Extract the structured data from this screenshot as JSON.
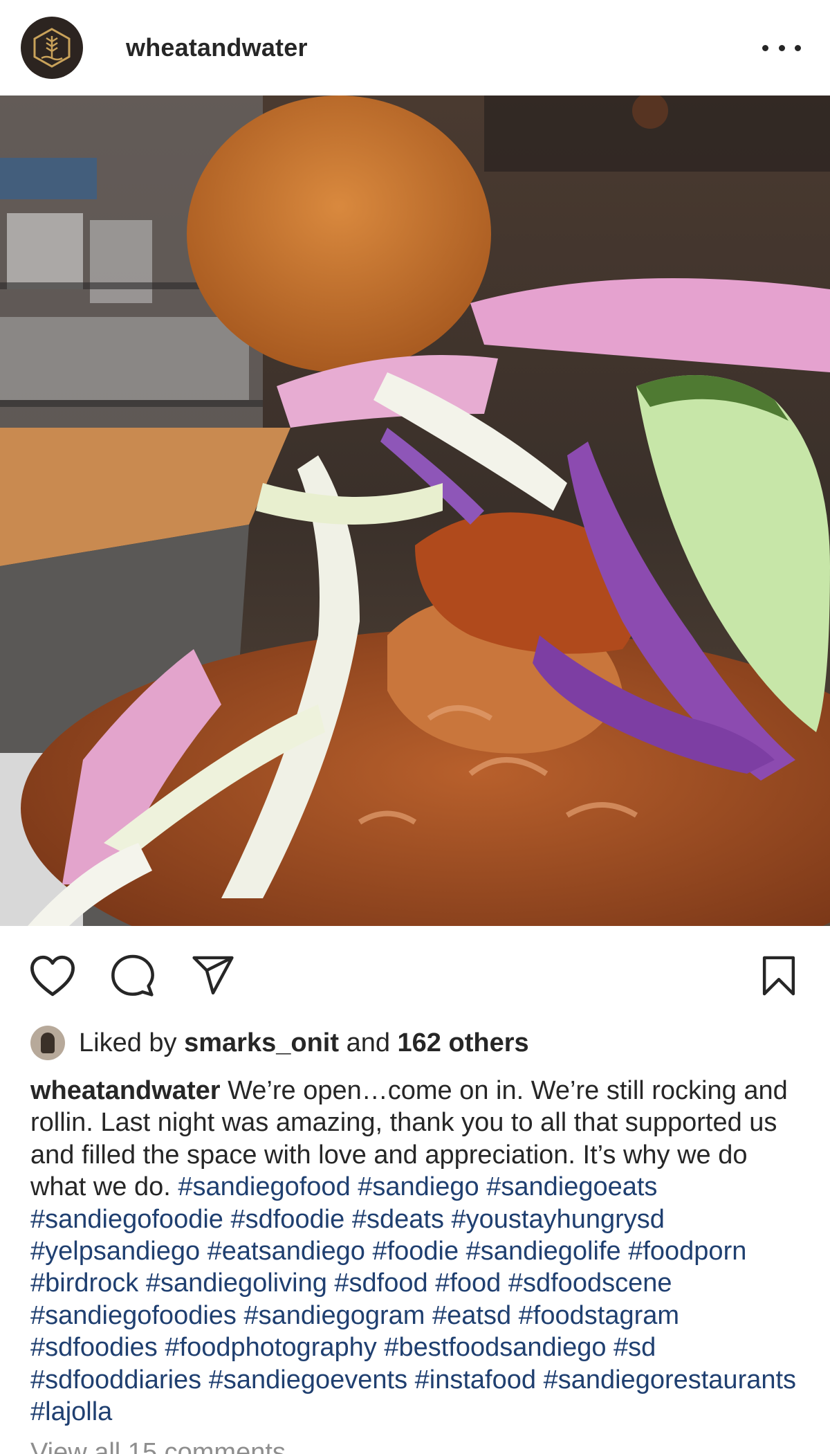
{
  "post": {
    "username": "wheatandwater",
    "more_icon": "more-horizontal-icon",
    "avatar_icon": "wheat-logo-icon"
  },
  "actions": {
    "like_icon": "heart-icon",
    "comment_icon": "comment-icon",
    "share_icon": "send-icon",
    "save_icon": "bookmark-icon"
  },
  "likes": {
    "prefix": "Liked by",
    "user": "smarks_onit",
    "middle": "and",
    "others": "162 others"
  },
  "caption": {
    "username": "wheatandwater",
    "text": "We’re open…come on in. We’re still rocking and rollin. Last night was amazing, thank you to all that supported us and filled the space with love and appreciation. It’s why we do what we do.",
    "hashtags": [
      "#sandiegofood",
      "#sandiego",
      "#sandiegoeats",
      "#sandiegofoodie",
      "#sdfoodie",
      "#sdeats",
      "#youstayhungrysd",
      "#yelpsandiego",
      "#eatsandiego",
      "#foodie",
      "#sandiegolife",
      "#foodporn",
      "#birdrock",
      "#sandiegoliving",
      "#sdfood",
      "#food",
      "#sdfoodscene",
      "#sandiegofoodies",
      "#sandiegogram",
      "#eatsd",
      "#foodstagram",
      "#sdfoodies",
      "#foodphotography",
      "#bestfoodsandiego",
      "#sd",
      "#sdfooddiaries",
      "#sandiegoevents",
      "#instafood",
      "#sandiegorestaurants",
      "#lajolla"
    ]
  },
  "comments": {
    "view_all": "View all 15 comments"
  },
  "colors": {
    "hashtag": "#1f3f70",
    "text": "#262626",
    "muted": "#8e8e8e"
  }
}
